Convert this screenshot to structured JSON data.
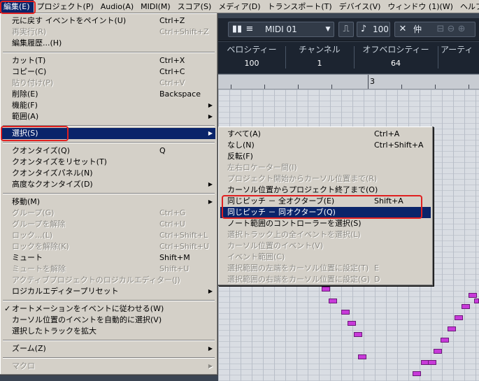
{
  "menubar": {
    "items": [
      "編集(E)",
      "プロジェクト(P)",
      "Audio(A)",
      "MIDI(M)",
      "スコア(S)",
      "メディア(D)",
      "トランスポート(T)",
      "デバイス(V)",
      "ウィンドウ (1)(W)",
      "ヘルプ(H)"
    ],
    "active_index": 0
  },
  "toolbar": {
    "midi_port": "MIDI 01",
    "velocity_value": "100",
    "kanji_label": "仲"
  },
  "infobar": {
    "columns": [
      {
        "label": "ベロシティー",
        "value": "100"
      },
      {
        "label": "チャンネル",
        "value": "1"
      },
      {
        "label": "オフベロシティー",
        "value": "64"
      },
      {
        "label": "アーティ",
        "value": ""
      }
    ]
  },
  "ruler": {
    "bar_label": "3"
  },
  "edit_menu": {
    "items": [
      {
        "label": "元に戻す イベントをペイント(U)",
        "shortcut": "Ctrl+Z",
        "disabled": false
      },
      {
        "label": "再実行(R)",
        "shortcut": "Ctrl+Shift+Z",
        "disabled": true
      },
      {
        "label": "編集履歴...(H)",
        "shortcut": "",
        "disabled": false
      },
      {
        "label": "カット(T)",
        "shortcut": "Ctrl+X",
        "disabled": false
      },
      {
        "label": "コピー(C)",
        "shortcut": "Ctrl+C",
        "disabled": false
      },
      {
        "label": "貼り付け(P)",
        "shortcut": "Ctrl+V",
        "disabled": true
      },
      {
        "label": "削除(E)",
        "shortcut": "Backspace",
        "disabled": false
      },
      {
        "label": "機能(F)",
        "shortcut": "",
        "disabled": false,
        "submenu": true
      },
      {
        "label": "範囲(A)",
        "shortcut": "",
        "disabled": false,
        "submenu": true
      },
      {
        "label": "選択(S)",
        "shortcut": "",
        "disabled": false,
        "submenu": true,
        "selected": true
      },
      {
        "label": "クオンタイズ(Q)",
        "shortcut": "Q",
        "disabled": false
      },
      {
        "label": "クオンタイズをリセット(T)",
        "shortcut": "",
        "disabled": false
      },
      {
        "label": "クオンタイズパネル(N)",
        "shortcut": "",
        "disabled": false
      },
      {
        "label": "高度なクオンタイズ(D)",
        "shortcut": "",
        "disabled": false,
        "submenu": true
      },
      {
        "label": "移動(M)",
        "shortcut": "",
        "disabled": false,
        "submenu": true
      },
      {
        "label": "グループ(G)",
        "shortcut": "Ctrl+G",
        "disabled": true
      },
      {
        "label": "グループを解除",
        "shortcut": "Ctrl+U",
        "disabled": true
      },
      {
        "label": "ロック...(L)",
        "shortcut": "Ctrl+Shift+L",
        "disabled": true
      },
      {
        "label": "ロックを解除(K)",
        "shortcut": "Ctrl+Shift+U",
        "disabled": true
      },
      {
        "label": "ミュート",
        "shortcut": "Shift+M",
        "disabled": false
      },
      {
        "label": "ミュートを解除",
        "shortcut": "Shift+U",
        "disabled": true
      },
      {
        "label": "アクティブプロジェクトのロジカルエディター(J)",
        "shortcut": "",
        "disabled": true
      },
      {
        "label": "ロジカルエディタープリセット",
        "shortcut": "",
        "disabled": false,
        "submenu": true
      },
      {
        "label": "オートメーションをイベントに従わせる(W)",
        "shortcut": "",
        "disabled": false,
        "checked": true
      },
      {
        "label": "カーソル位置のイベントを自動的に選択(V)",
        "shortcut": "",
        "disabled": false
      },
      {
        "label": "選択したトラックを拡大",
        "shortcut": "",
        "disabled": false
      },
      {
        "label": "ズーム(Z)",
        "shortcut": "",
        "disabled": false,
        "submenu": true
      },
      {
        "label": "マクロ",
        "shortcut": "",
        "disabled": true,
        "submenu": true
      }
    ],
    "check_mark": "✓",
    "submenu_arrow": "▶"
  },
  "select_menu": {
    "items": [
      {
        "label": "すべて(A)",
        "shortcut": "Ctrl+A",
        "disabled": false
      },
      {
        "label": "なし(N)",
        "shortcut": "Ctrl+Shift+A",
        "disabled": false
      },
      {
        "label": "反転(F)",
        "shortcut": "",
        "disabled": false
      },
      {
        "label": "左右ロケーター間(I)",
        "shortcut": "",
        "disabled": true
      },
      {
        "label": "プロジェクト開始からカーソル位置まで(R)",
        "shortcut": "",
        "disabled": true
      },
      {
        "label": "カーソル位置からプロジェクト終了まで(O)",
        "shortcut": "",
        "disabled": false
      },
      {
        "label": "同じピッチ － 全オクターブ(E)",
        "shortcut": "Shift+A",
        "disabled": false
      },
      {
        "label": "同じピッチ － 同オクターブ(Q)",
        "shortcut": "",
        "disabled": false,
        "selected": true
      },
      {
        "label": "ノート範囲のコントローラーを選択(S)",
        "shortcut": "",
        "disabled": false
      },
      {
        "label": "選択トラック上の全イベントを選択(L)",
        "shortcut": "",
        "disabled": true
      },
      {
        "label": "カーソル位置のイベント(V)",
        "shortcut": "",
        "disabled": true
      },
      {
        "label": "イベント範囲(C)",
        "shortcut": "",
        "disabled": true
      },
      {
        "label": "選択範囲の左端をカーソル位置に設定(T)",
        "shortcut": "E",
        "disabled": true
      },
      {
        "label": "選択範囲の右端をカーソル位置に設定(G)",
        "shortcut": "D",
        "disabled": true
      }
    ]
  }
}
